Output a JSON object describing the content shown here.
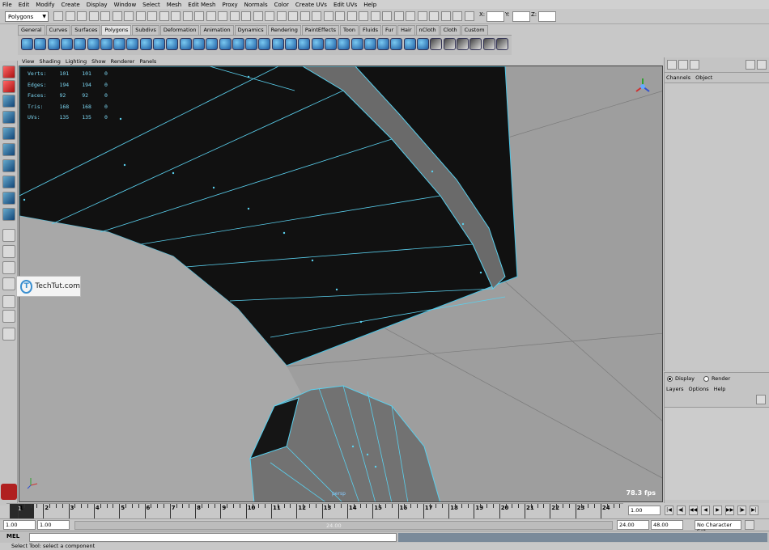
{
  "menubar": [
    "File",
    "Edit",
    "Modify",
    "Create",
    "Display",
    "Window",
    "Select",
    "Mesh",
    "Edit Mesh",
    "Proxy",
    "Normals",
    "Color",
    "Create UVs",
    "Edit UVs",
    "Help"
  ],
  "status_line": {
    "mode": "Polygons",
    "x_label": "X:",
    "y_label": "Y:",
    "z_label": "Z:"
  },
  "shelf_tabs": [
    "General",
    "Curves",
    "Surfaces",
    "Polygons",
    "Subdivs",
    "Deformation",
    "Animation",
    "Dynamics",
    "Rendering",
    "PaintEffects",
    "Toon",
    "Fluids",
    "Fur",
    "Hair",
    "nCloth",
    "Cloth",
    "Custom"
  ],
  "shelf_active_tab": "Polygons",
  "viewport_menu": [
    "View",
    "Shading",
    "Lighting",
    "Show",
    "Renderer",
    "Panels"
  ],
  "hud": {
    "rows": [
      {
        "label": "Verts:",
        "a": "101",
        "b": "101",
        "c": "0"
      },
      {
        "label": "Edges:",
        "a": "194",
        "b": "194",
        "c": "0"
      },
      {
        "label": "Faces:",
        "a": "92",
        "b": "92",
        "c": "0"
      },
      {
        "label": "Tris:",
        "a": "168",
        "b": "168",
        "c": "0"
      },
      {
        "label": "UVs:",
        "a": "135",
        "b": "135",
        "c": "0"
      }
    ],
    "camera": "persp",
    "fps": "78.3 fps"
  },
  "watermark": {
    "letter": "T",
    "text": "TechTut.com"
  },
  "channel_box": {
    "menu": [
      "Channels",
      "Object"
    ]
  },
  "layer_editor": {
    "display_label": "Display",
    "render_label": "Render",
    "menu": [
      "Layers",
      "Options",
      "Help"
    ]
  },
  "time_slider": {
    "ticks": [
      "1",
      "2",
      "3",
      "4",
      "5",
      "6",
      "7",
      "8",
      "9",
      "10",
      "11",
      "12",
      "13",
      "14",
      "15",
      "16",
      "17",
      "18",
      "19",
      "20",
      "21",
      "22",
      "23",
      "24"
    ],
    "current_frame": "1",
    "current_field": "1.00"
  },
  "range": {
    "start": "1.00",
    "playback_start": "1.00",
    "end_label": "24.00",
    "playback_end": "24.00",
    "anim_end": "48.00",
    "character": "No Character Set"
  },
  "command_line": {
    "label": "MEL"
  },
  "help_line": "Select Tool: select a component",
  "colors": {
    "wire": "#5ad0ee",
    "mesh_dark": "#0e0e0e",
    "viewport_bg": "#9e9e9e"
  }
}
